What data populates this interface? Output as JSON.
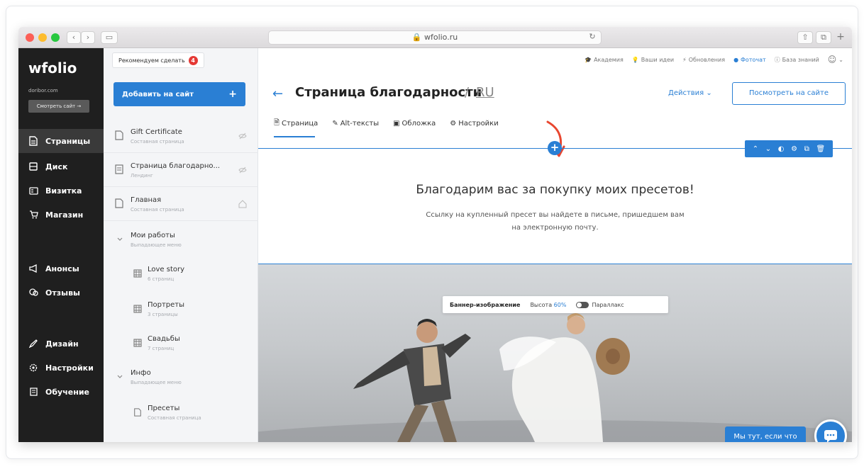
{
  "browser": {
    "url": "wfolio.ru"
  },
  "colors": {
    "accent": "#2a7fd4",
    "sidebar_bg": "#1f1f1f",
    "badge": "#e53935",
    "arrow": "#e8462f"
  },
  "sidebar": {
    "logo": "wfolio",
    "domain": "doribor.com",
    "view_site": "Смотреть сайт →",
    "items": [
      {
        "label": "Страницы",
        "icon": "page-icon",
        "active": true
      },
      {
        "label": "Диск",
        "icon": "disk-icon"
      },
      {
        "label": "Визитка",
        "icon": "card-icon"
      },
      {
        "label": "Магазин",
        "icon": "cart-icon"
      },
      {
        "label": "Анонсы",
        "icon": "megaphone-icon"
      },
      {
        "label": "Отзывы",
        "icon": "reviews-icon"
      },
      {
        "label": "Дизайн",
        "icon": "brush-icon"
      },
      {
        "label": "Настройки",
        "icon": "gear-icon"
      },
      {
        "label": "Обучение",
        "icon": "book-icon"
      }
    ]
  },
  "pages_panel": {
    "recommend_label": "Рекомендуем сделать",
    "recommend_count": "4",
    "add_label": "Добавить на сайт",
    "add_plus": "+",
    "pages": [
      {
        "title": "Gift Certificate",
        "subtitle": "Составная страница"
      },
      {
        "title": "Страница благодарно...",
        "subtitle": "Лендинг"
      },
      {
        "title": "Главная",
        "subtitle": "Составная страница"
      }
    ],
    "groups": [
      {
        "title": "Мои работы",
        "subtitle": "Выпадающее меню",
        "children": [
          {
            "title": "Love story",
            "subtitle": "6 страниц"
          },
          {
            "title": "Портреты",
            "subtitle": "3 страницы"
          },
          {
            "title": "Свадьбы",
            "subtitle": "7 страниц"
          }
        ]
      },
      {
        "title": "Инфо",
        "subtitle": "Выпадающее меню",
        "children": [
          {
            "title": "Пресеты",
            "subtitle": "Составная страница"
          }
        ]
      }
    ]
  },
  "topnav": {
    "academy": "Академия",
    "ideas": "Ваши идеи",
    "updates": "Обновления",
    "photochat": "Фоточат",
    "kb": "База знаний"
  },
  "page": {
    "title": "Страница благодарности",
    "lang_sep": "/",
    "lang": "RU",
    "actions": "Действия ⌄",
    "view_site": "Посмотреть на сайте",
    "tabs": [
      "Страница",
      "Alt-тексты",
      "Обложка",
      "Настройки"
    ]
  },
  "content": {
    "heading": "Благодарим вас за покупку моих пресетов!",
    "line1": "Ссылку на купленный пресет вы найдете в письме, пришедшем вам",
    "line2": "на электронную почту."
  },
  "banner_bar": {
    "label": "Баннер-изображение",
    "height_label": "Высота",
    "height_value": "60%",
    "parallax": "Параллакс"
  },
  "chat": {
    "message": "Мы тут, если что"
  }
}
